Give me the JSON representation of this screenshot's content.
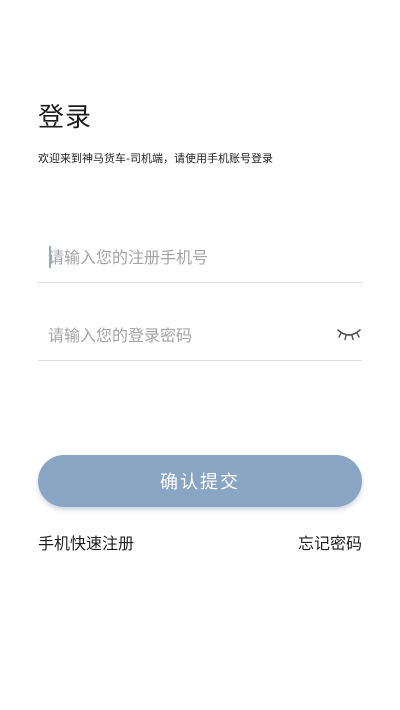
{
  "header": {
    "title": "登录",
    "subtitle": "欢迎来到神马货车-司机端，请使用手机账号登录"
  },
  "form": {
    "phone_placeholder": "请输入您的注册手机号",
    "phone_value": "",
    "password_placeholder": "请输入您的登录密码",
    "password_value": "",
    "password_toggle_icon": "eye-closed-icon",
    "submit_label": "确认提交"
  },
  "links": {
    "register": "手机快速注册",
    "forgot_password": "忘记密码"
  },
  "colors": {
    "accent": "#8aa4c4",
    "divider": "#dddddd",
    "placeholder": "#a4a4a4",
    "caret": "#8fb0b0"
  }
}
